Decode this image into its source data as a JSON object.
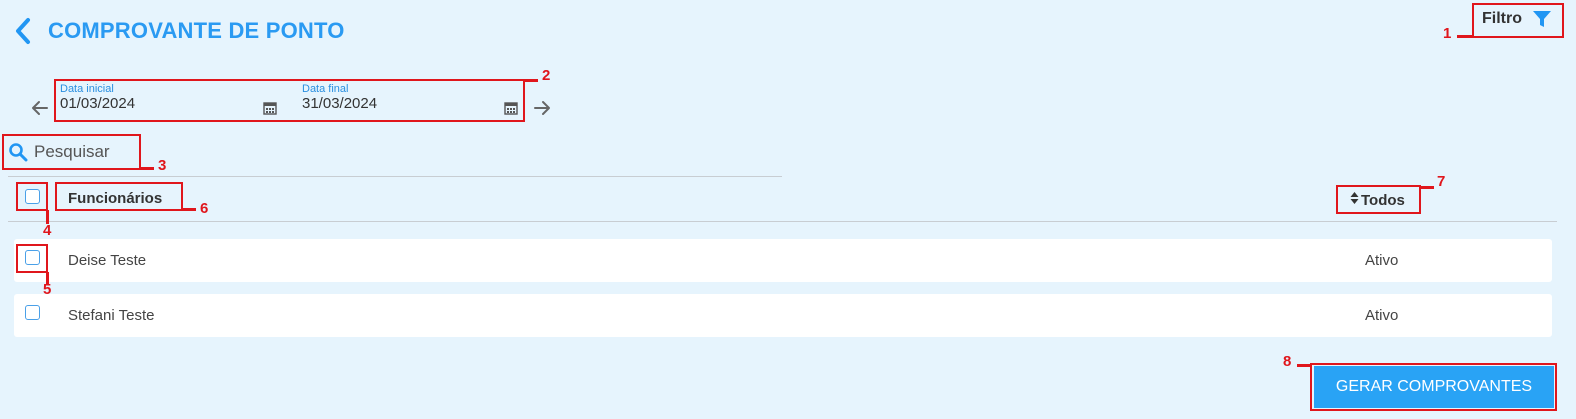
{
  "header": {
    "title": "COMPROVANTE DE PONTO",
    "filter_label": "Filtro"
  },
  "dates": {
    "start_label": "Data inicial",
    "start_value": "01/03/2024",
    "end_label": "Data final",
    "end_value": "31/03/2024"
  },
  "search": {
    "placeholder": "Pesquisar"
  },
  "table": {
    "column_employees": "Funcionários",
    "column_status": "Todos",
    "rows": [
      {
        "name": "Deise Teste",
        "status": "Ativo"
      },
      {
        "name": "Stefani Teste",
        "status": "Ativo"
      }
    ]
  },
  "actions": {
    "generate_label": "GERAR COMPROVANTES"
  },
  "annotations": [
    "1",
    "2",
    "3",
    "4",
    "5",
    "6",
    "7",
    "8"
  ],
  "colors": {
    "accent": "#2196f3",
    "annotation": "#e0161c",
    "background": "#e6f4fd",
    "button": "#29a3f5"
  },
  "icons": [
    "back-icon",
    "filter-icon",
    "arrow-left-icon",
    "calendar-icon",
    "arrow-right-icon",
    "search-icon",
    "sort-icon"
  ]
}
